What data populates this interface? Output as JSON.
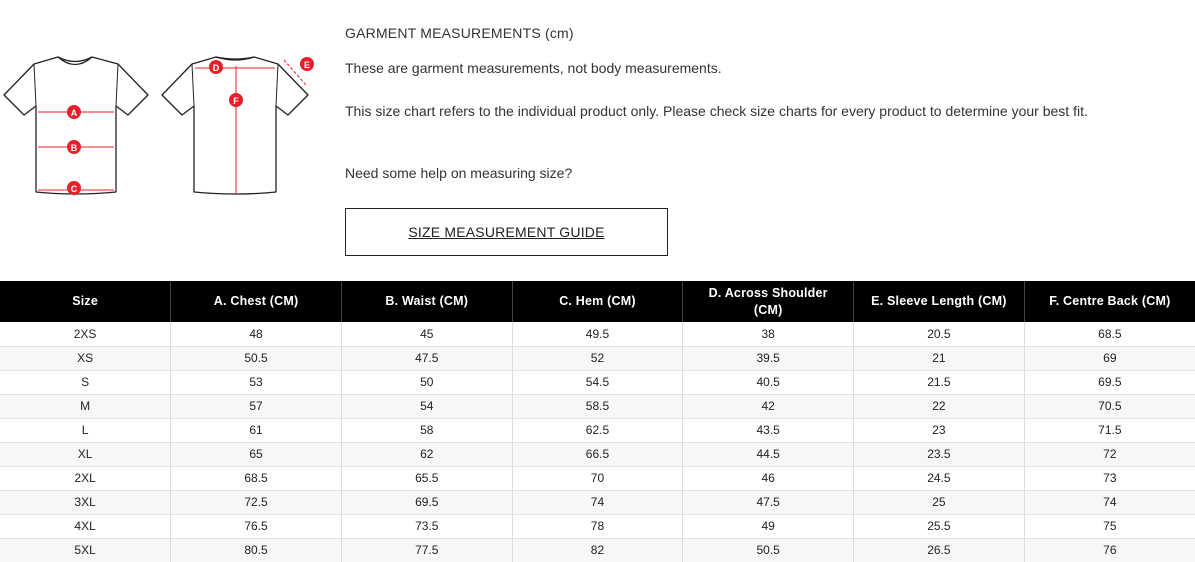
{
  "diagram": {
    "front_markers": [
      "A",
      "B",
      "C"
    ],
    "back_markers": [
      "D",
      "E",
      "F"
    ],
    "marker_color": "#e8202a"
  },
  "info": {
    "title": "GARMENT MEASUREMENTS (cm)",
    "note1": "These are garment measurements, not body measurements.",
    "note2": "This size chart refers to the individual product only. Please check size charts for every product to determine your best fit.",
    "note3": "Need some help on measuring size?",
    "guide_button": "SIZE MEASUREMENT GUIDE"
  },
  "table": {
    "headers": [
      "Size",
      "A. Chest (CM)",
      "B. Waist (CM)",
      "C. Hem (CM)",
      "D. Across Shoulder (CM)",
      "E. Sleeve Length (CM)",
      "F. Centre Back (CM)"
    ],
    "rows": [
      [
        "2XS",
        "48",
        "45",
        "49.5",
        "38",
        "20.5",
        "68.5"
      ],
      [
        "XS",
        "50.5",
        "47.5",
        "52",
        "39.5",
        "21",
        "69"
      ],
      [
        "S",
        "53",
        "50",
        "54.5",
        "40.5",
        "21.5",
        "69.5"
      ],
      [
        "M",
        "57",
        "54",
        "58.5",
        "42",
        "22",
        "70.5"
      ],
      [
        "L",
        "61",
        "58",
        "62.5",
        "43.5",
        "23",
        "71.5"
      ],
      [
        "XL",
        "65",
        "62",
        "66.5",
        "44.5",
        "23.5",
        "72"
      ],
      [
        "2XL",
        "68.5",
        "65.5",
        "70",
        "46",
        "24.5",
        "73"
      ],
      [
        "3XL",
        "72.5",
        "69.5",
        "74",
        "47.5",
        "25",
        "74"
      ],
      [
        "4XL",
        "76.5",
        "73.5",
        "78",
        "49",
        "25.5",
        "75"
      ],
      [
        "5XL",
        "80.5",
        "77.5",
        "82",
        "50.5",
        "26.5",
        "76"
      ]
    ]
  }
}
